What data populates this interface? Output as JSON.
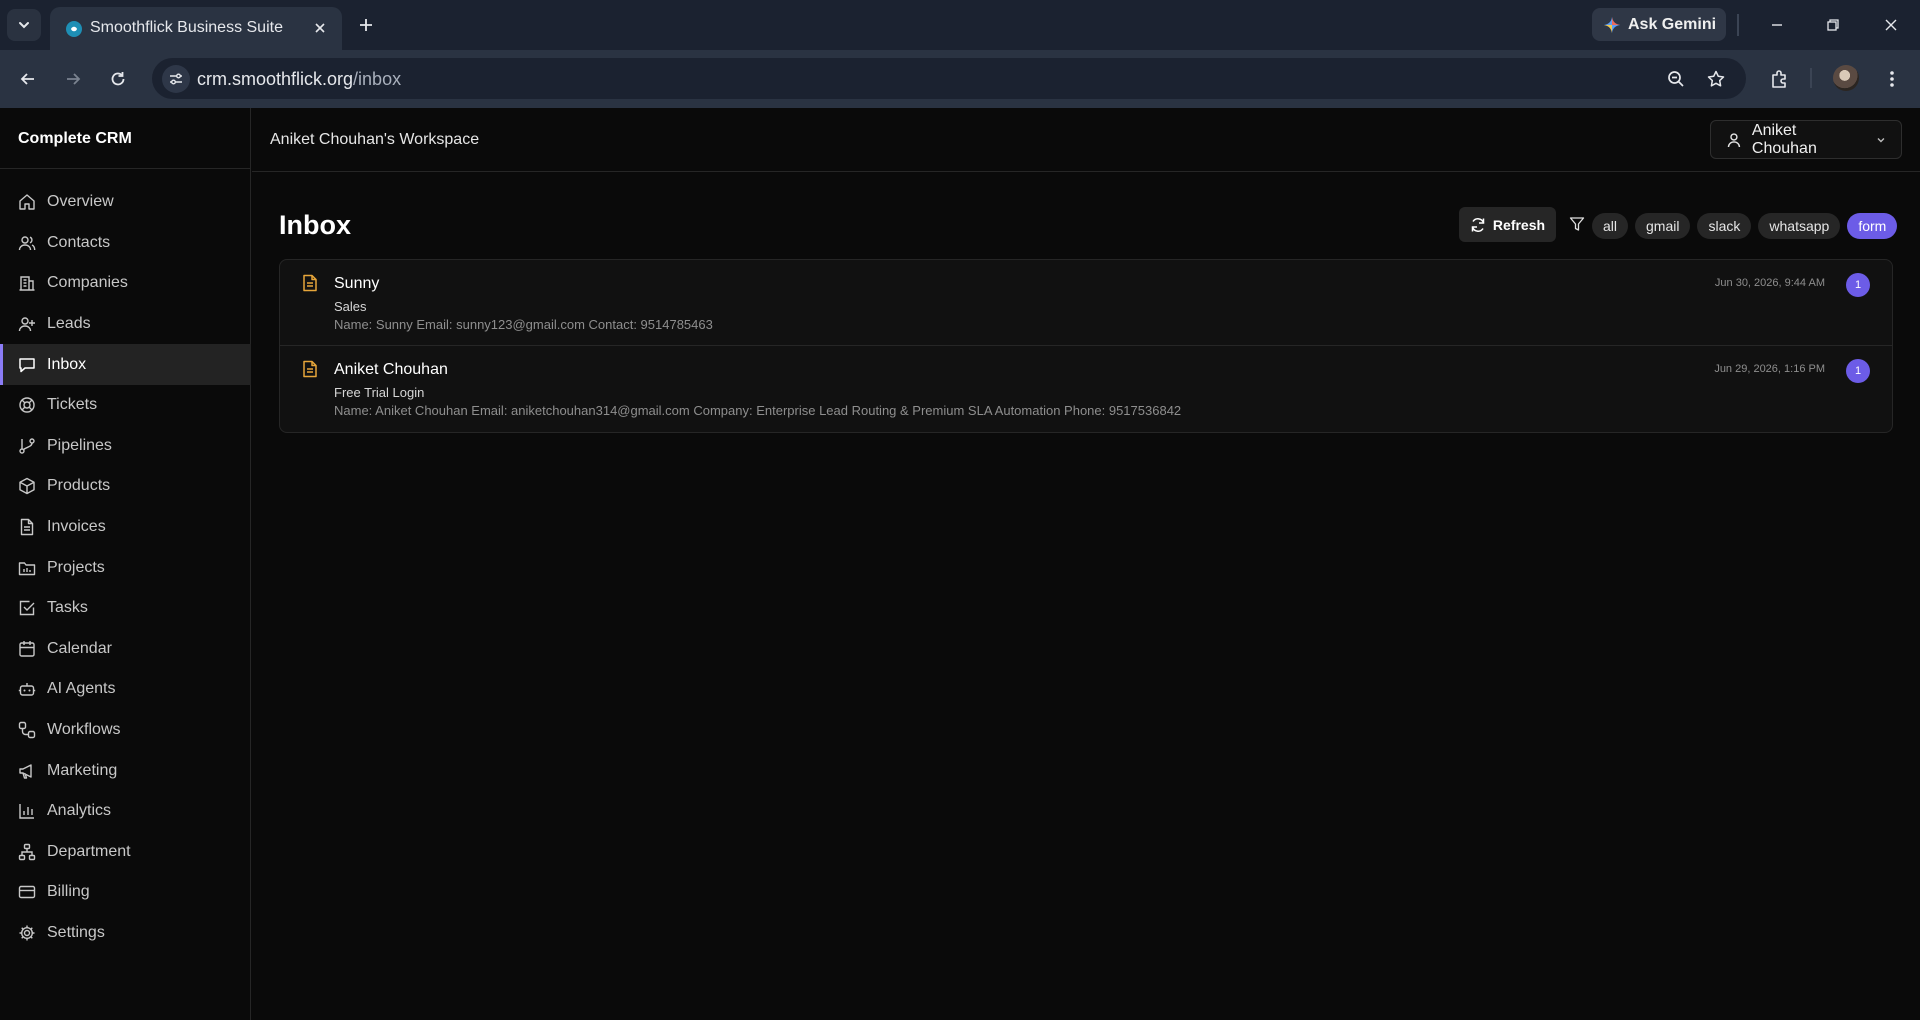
{
  "browser": {
    "tab_title": "Smoothflick Business Suite",
    "url_host": "crm.smoothflick.org",
    "url_path": "/inbox",
    "gemini_label": "Ask Gemini"
  },
  "app": {
    "brand": "Complete CRM",
    "workspace": "Aniket Chouhan's Workspace",
    "user_name": "Aniket Chouhan"
  },
  "sidebar": {
    "items": [
      {
        "label": "Overview",
        "icon": "home-icon"
      },
      {
        "label": "Contacts",
        "icon": "users-icon"
      },
      {
        "label": "Companies",
        "icon": "building-icon"
      },
      {
        "label": "Leads",
        "icon": "user-plus-icon"
      },
      {
        "label": "Inbox",
        "icon": "message-icon",
        "active": true
      },
      {
        "label": "Tickets",
        "icon": "lifebuoy-icon"
      },
      {
        "label": "Pipelines",
        "icon": "git-branch-icon"
      },
      {
        "label": "Products",
        "icon": "package-icon"
      },
      {
        "label": "Invoices",
        "icon": "file-text-icon"
      },
      {
        "label": "Projects",
        "icon": "folder-chart-icon"
      },
      {
        "label": "Tasks",
        "icon": "check-square-icon"
      },
      {
        "label": "Calendar",
        "icon": "calendar-icon"
      },
      {
        "label": "AI Agents",
        "icon": "bot-icon"
      },
      {
        "label": "Workflows",
        "icon": "workflow-icon"
      },
      {
        "label": "Marketing",
        "icon": "megaphone-icon"
      },
      {
        "label": "Analytics",
        "icon": "bar-chart-icon"
      },
      {
        "label": "Department",
        "icon": "network-icon"
      },
      {
        "label": "Billing",
        "icon": "credit-card-icon"
      },
      {
        "label": "Settings",
        "icon": "gear-icon"
      }
    ]
  },
  "inbox": {
    "title": "Inbox",
    "refresh_label": "Refresh",
    "filters": [
      {
        "label": "all"
      },
      {
        "label": "gmail"
      },
      {
        "label": "slack"
      },
      {
        "label": "whatsapp"
      },
      {
        "label": "form",
        "active": true
      }
    ],
    "messages": [
      {
        "name": "Sunny",
        "subject": "Sales",
        "preview": "Name: Sunny Email: sunny123@gmail.com Contact: 9514785463",
        "time": "Jun 30, 2026, 9:44 AM",
        "count": "1"
      },
      {
        "name": "Aniket Chouhan",
        "subject": "Free Trial Login",
        "preview": "Name: Aniket Chouhan Email: aniketchouhan314@gmail.com Company: Enterprise Lead Routing & Premium SLA Automation Phone: 9517536842",
        "time": "Jun 29, 2026, 1:16 PM",
        "count": "1"
      }
    ]
  },
  "colors": {
    "accent": "#6c5ce7",
    "active_bar": "#8b7cf6",
    "form_icon": "#e7a63a"
  }
}
